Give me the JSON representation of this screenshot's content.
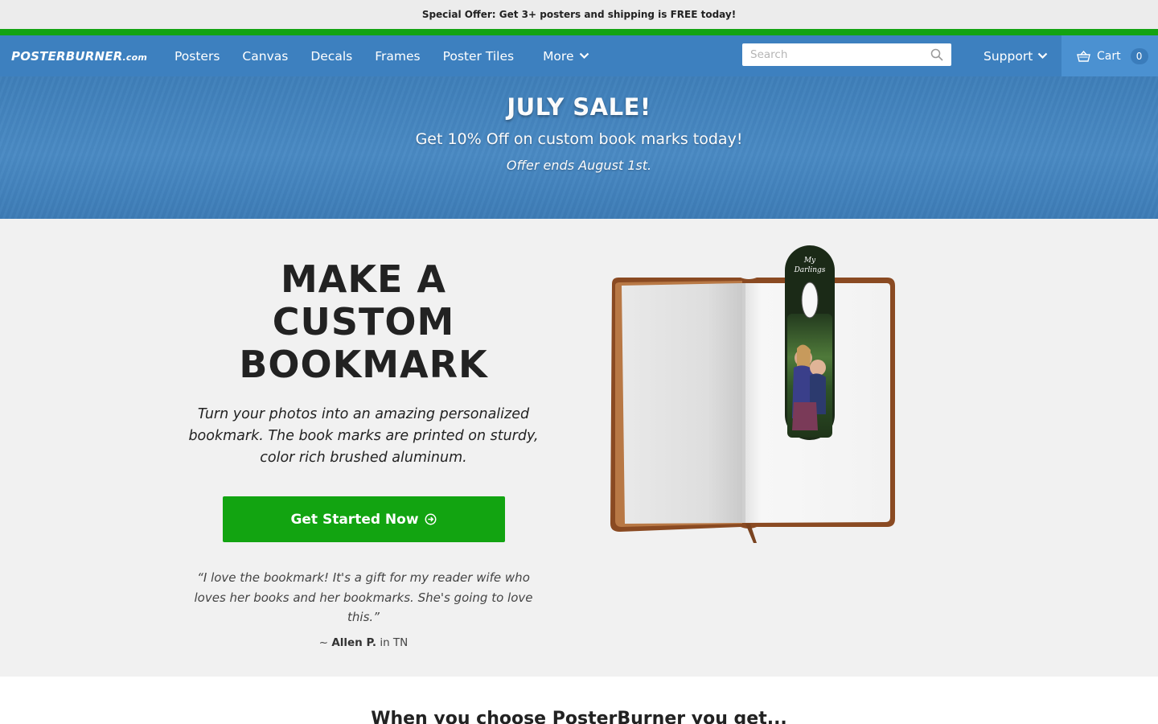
{
  "promo": {
    "text": "Special Offer: Get 3+ posters and shipping is FREE today!"
  },
  "nav": {
    "brand": "POSTERBURNER",
    "brand_tld": ".com",
    "links": [
      "Posters",
      "Canvas",
      "Decals",
      "Frames",
      "Poster Tiles"
    ],
    "more_label": "More",
    "search_placeholder": "Search",
    "support_label": "Support",
    "cart_label": "Cart",
    "cart_count": "0",
    "icons": {
      "search": "search-icon",
      "cart": "basket-icon",
      "chevron": "chevron-down-icon"
    }
  },
  "sale": {
    "title": "JULY SALE!",
    "subtitle": "Get 10% Off on custom book marks today!",
    "note": "Offer ends August 1st."
  },
  "hero": {
    "title": "MAKE A CUSTOM BOOKMARK",
    "description": "Turn your photos into an amazing personalized bookmark. The book marks are printed on sturdy, color rich brushed aluminum.",
    "cta_label": "Get Started Now",
    "quote": "“I love the bookmark! It's a gift for my reader wife who loves her books and her bookmarks. She's going to love this.”",
    "attrib_prefix": "~",
    "attrib_name": "Allen P.",
    "attrib_location": "in TN",
    "bookmark_text_line1": "My",
    "bookmark_text_line2": "Darlings"
  },
  "section": {
    "title": "When you choose PosterBurner you get..."
  },
  "colors": {
    "nav_blue": "#3d80bf",
    "cta_green": "#12a411",
    "stripe_green": "#13a312"
  }
}
